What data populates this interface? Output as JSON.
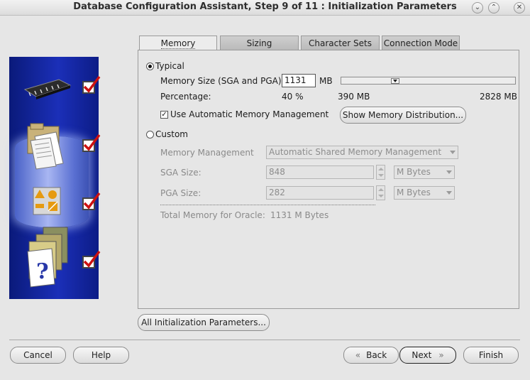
{
  "window": {
    "title": "Database Configuration Assistant, Step 9 of 11 : Initialization Parameters",
    "controls": {
      "minimize": "⌄",
      "maximize": "⌃",
      "close": "✕"
    }
  },
  "tabs": [
    {
      "label": "Memory",
      "selected": true
    },
    {
      "label": "Sizing",
      "selected": false
    },
    {
      "label": "Character Sets",
      "selected": false
    },
    {
      "label": "Connection Mode",
      "selected": false
    }
  ],
  "memory": {
    "typical_label": "Typical",
    "typical_selected": true,
    "memory_size_label": "Memory Size (SGA and PGA):",
    "memory_size_value": "1131",
    "memory_size_unit": "MB",
    "percentage_label": "Percentage:",
    "percentage_value": "40 %",
    "slider_min": "390 MB",
    "slider_max": "2828 MB",
    "slider_fraction": 0.3,
    "auto_mm_label": "Use Automatic Memory Management",
    "auto_mm_checked": true,
    "show_distribution_button": "Show Memory Distribution...",
    "custom_label": "Custom",
    "custom_selected": false,
    "memory_management_label": "Memory Management",
    "memory_management_value": "Automatic Shared Memory Management",
    "sga_label": "SGA Size:",
    "sga_value": "848",
    "sga_unit": "M Bytes",
    "pga_label": "PGA Size:",
    "pga_value": "282",
    "pga_unit": "M Bytes",
    "total_label": "Total Memory for Oracle:",
    "total_value": "1131 M Bytes"
  },
  "all_params_button": "All Initialization Parameters...",
  "footer": {
    "cancel": "Cancel",
    "help": "Help",
    "back": "Back",
    "next": "Next",
    "finish": "Finish"
  },
  "colors": {
    "side_panel": "#1b2fb8",
    "check_mark": "#cc1111"
  }
}
